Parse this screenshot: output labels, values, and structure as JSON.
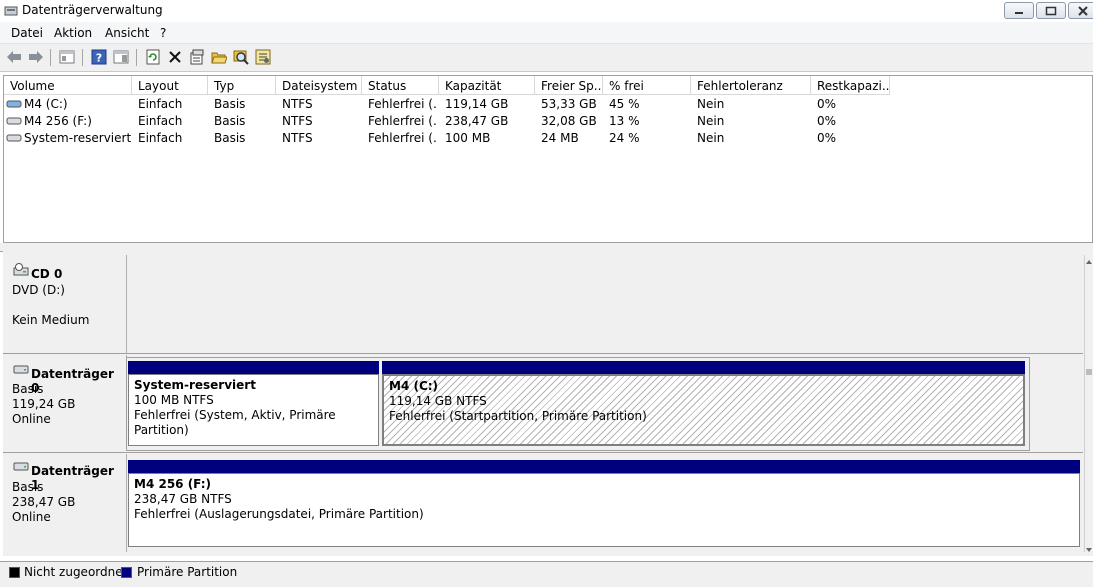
{
  "window": {
    "title": "Datenträgerverwaltung"
  },
  "menu": [
    "Datei",
    "Aktion",
    "Ansicht",
    "?"
  ],
  "toolbar": {
    "icons": [
      "back-arrow-icon",
      "forward-arrow-icon",
      "console-tree-icon",
      "help-icon",
      "properties-pane-icon",
      "refresh-icon",
      "delete-icon",
      "properties-icon",
      "open-folder-icon",
      "search-icon",
      "settings-icon"
    ]
  },
  "volume_list": {
    "columns": [
      "Volume",
      "Layout",
      "Typ",
      "Dateisystem",
      "Status",
      "Kapazität",
      "Freier Sp...",
      "% frei",
      "Fehlertoleranz",
      "Restkapazi..."
    ],
    "rows": [
      [
        "M4 (C:)",
        "Einfach",
        "Basis",
        "NTFS",
        "Fehlerfrei (...",
        "119,14 GB",
        "53,33 GB",
        "45 %",
        "Nein",
        "0%"
      ],
      [
        "M4 256 (F:)",
        "Einfach",
        "Basis",
        "NTFS",
        "Fehlerfrei (...",
        "238,47 GB",
        "32,08 GB",
        "13 %",
        "Nein",
        "0%"
      ],
      [
        "System-reserviert",
        "Einfach",
        "Basis",
        "NTFS",
        "Fehlerfrei (...",
        "100 MB",
        "24 MB",
        "24 %",
        "Nein",
        "0%"
      ]
    ]
  },
  "disks": {
    "cd0": {
      "name": "CD 0",
      "line1": "DVD (D:)",
      "line2": "Kein Medium"
    },
    "disk0": {
      "name": "Datenträger 0",
      "type": "Basis",
      "size": "119,24 GB",
      "state": "Online",
      "partitions": [
        {
          "name": "System-reserviert",
          "size": "100 MB NTFS",
          "status": "Fehlerfrei (System, Aktiv, Primäre Partition)"
        },
        {
          "name": "M4  (C:)",
          "size": "119,14 GB NTFS",
          "status": "Fehlerfrei (Startpartition, Primäre Partition)"
        }
      ]
    },
    "disk1": {
      "name": "Datenträger 1",
      "type": "Basis",
      "size": "238,47 GB",
      "state": "Online",
      "partitions": [
        {
          "name": "M4 256  (F:)",
          "size": "238,47 GB NTFS",
          "status": "Fehlerfrei (Auslagerungsdatei, Primäre Partition)"
        }
      ]
    }
  },
  "legend": {
    "items": [
      {
        "label": "Nicht zugeordnet",
        "color": "#000000"
      },
      {
        "label": "Primäre Partition",
        "color": "#00007f"
      }
    ]
  },
  "colors": {
    "partition_header": "#00007f",
    "unallocated": "#000000"
  }
}
